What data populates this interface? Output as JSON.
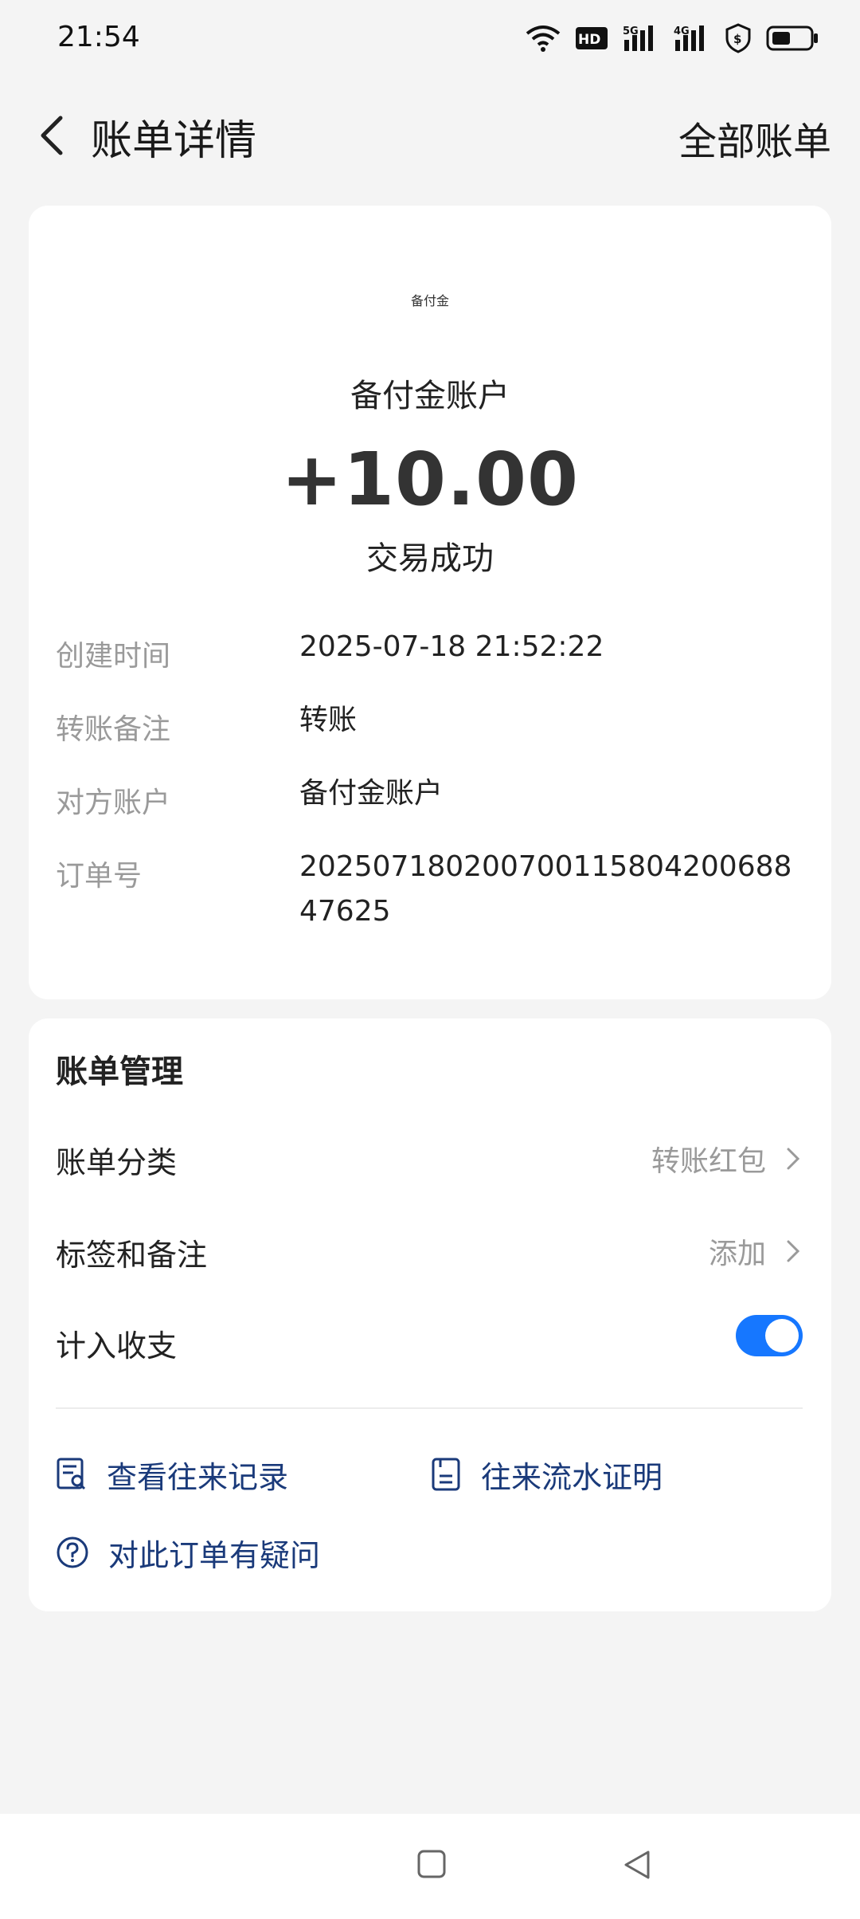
{
  "status_bar": {
    "time": "21:54",
    "icons": [
      "wifi-icon",
      "hd-icon",
      "signal-5g-icon",
      "signal-4g-icon",
      "security-shield-icon",
      "battery-icon"
    ]
  },
  "nav": {
    "title": "账单详情",
    "right_action": "全部账单"
  },
  "transaction": {
    "logo_text": "备付金",
    "account": "备付金账户",
    "amount": "+10.00",
    "status": "交易成功",
    "details": [
      {
        "label": "创建时间",
        "value": "2025-07-18 21:52:22"
      },
      {
        "label": "转账备注",
        "value": "转账"
      },
      {
        "label": "对方账户",
        "value": "备付金账户"
      },
      {
        "label": "订单号",
        "value": "20250718020070011580420068847625"
      }
    ]
  },
  "management": {
    "title": "账单管理",
    "category_label": "账单分类",
    "category_value": "转账红包",
    "tags_label": "标签和备注",
    "tags_value": "添加",
    "include_label": "计入收支",
    "include_enabled": true,
    "links": {
      "records": "查看往来记录",
      "statement": "往来流水证明",
      "question": "对此订单有疑问"
    }
  },
  "colors": {
    "accent": "#1677ff",
    "link": "#1a3a7a",
    "background": "#f4f4f4"
  }
}
